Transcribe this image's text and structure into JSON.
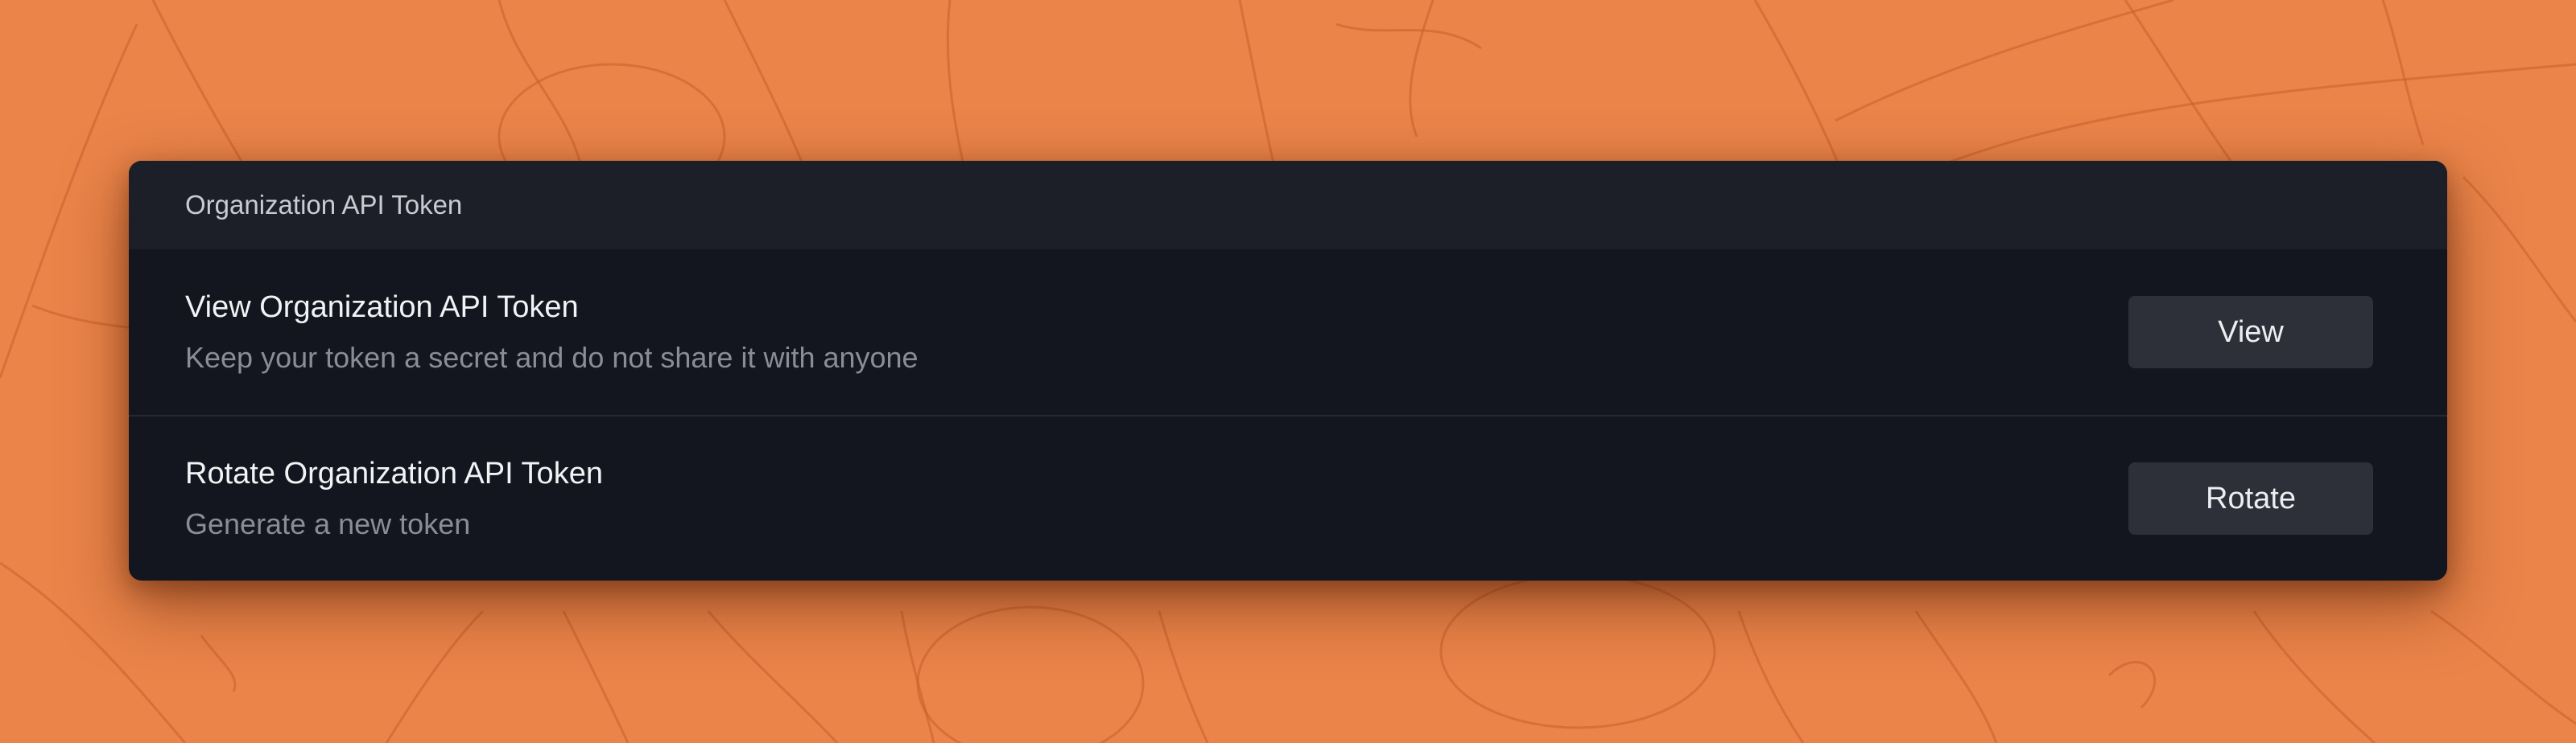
{
  "colors": {
    "background": "#ea8449",
    "panel": "#13161e",
    "panel_header": "#1c1e28",
    "button": "#2e3039"
  },
  "panel": {
    "title": "Organization API Token",
    "rows": [
      {
        "title": "View Organization API Token",
        "description": "Keep your token a secret and do not share it with anyone",
        "button_label": "View"
      },
      {
        "title": "Rotate Organization API Token",
        "description": "Generate a new token",
        "button_label": "Rotate"
      }
    ]
  }
}
